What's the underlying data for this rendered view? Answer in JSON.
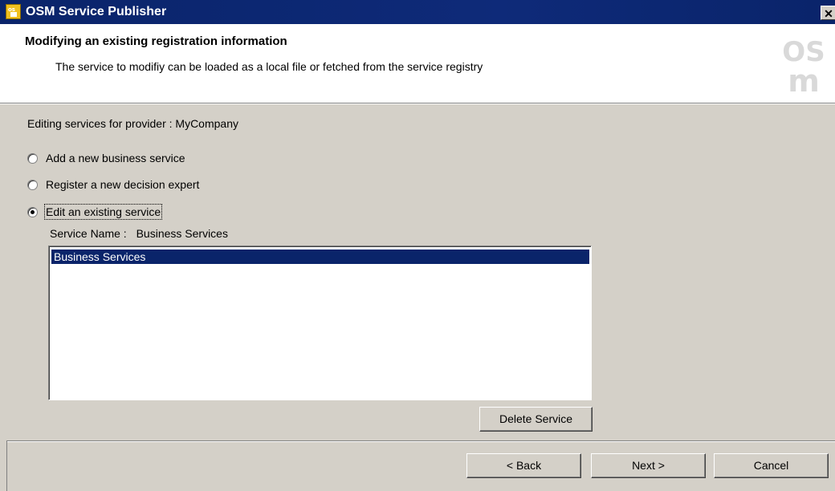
{
  "window": {
    "title": "OSM Service Publisher",
    "close_glyph": "✕"
  },
  "header": {
    "heading": "Modifying an existing registration information",
    "subtitle": "The service to modifiy can be loaded as a local file or fetched from the service registry",
    "logo_text_top": "OS",
    "logo_text_bottom": "m"
  },
  "body": {
    "provider_text": "Editing services for provider : MyCompany",
    "options": [
      {
        "label": "Add a new business service",
        "selected": false
      },
      {
        "label": "Register a new decision expert",
        "selected": false
      },
      {
        "label": "Edit an existing service",
        "selected": true
      }
    ],
    "service_name_label": "Service Name :",
    "service_name_value": "Business Services",
    "services_list": [
      "Business Services"
    ],
    "delete_button": "Delete Service"
  },
  "footer": {
    "back_button": "< Back",
    "next_button": "Next >",
    "cancel_button": "Cancel"
  },
  "colors": {
    "titlebar": "#0a246a",
    "face": "#d4d0c8",
    "selection": "#0a246a"
  }
}
